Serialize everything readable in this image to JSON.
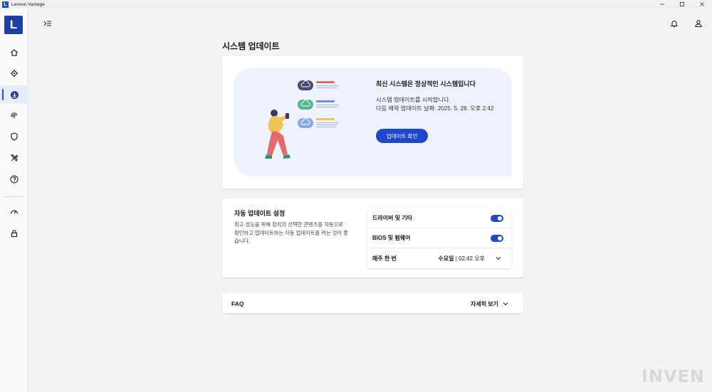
{
  "window": {
    "title": "Lenovo Vantage",
    "logo_letter": "L",
    "brand_color": "#1d4ed8"
  },
  "sidebar": {
    "brand_letter": "L",
    "items": [
      {
        "name": "home-icon",
        "active": false
      },
      {
        "name": "gear-icon",
        "active": false
      },
      {
        "name": "download-icon",
        "active": true
      },
      {
        "name": "fingerprint-icon",
        "active": false
      },
      {
        "name": "shield-icon",
        "active": false
      },
      {
        "name": "tools-icon",
        "active": false
      },
      {
        "name": "help-icon",
        "active": false
      },
      {
        "name": "gauge-icon",
        "active": false
      },
      {
        "name": "lock-icon",
        "active": false
      }
    ]
  },
  "page": {
    "title": "시스템 업데이트"
  },
  "status": {
    "title": "최신 시스템은 정상적인 시스템입니다",
    "line1": "시스템 업데이트를 시작합니다.",
    "line2": "다음 예약 업데이트 날짜: 2025. 5. 28. 오후 2:42",
    "button": "업데이트 확인"
  },
  "auto_update": {
    "title": "자동 업데이트 설정",
    "description": "최고 성능을 위해 장치의 선택한 콘텐츠를 자동으로 확인하고 업데이트하는 자동 업데이트를 켜는 것이 좋습니다.",
    "rows": [
      {
        "label": "드라이버 및 기타",
        "enabled": true
      },
      {
        "label": "BIOS 및 펌웨어",
        "enabled": true
      }
    ],
    "schedule": {
      "label": "매주 한 번",
      "day": "수요일",
      "separator": " | ",
      "time": "02:42 오후"
    }
  },
  "faq": {
    "label": "FAQ",
    "more": "자세히 보기"
  },
  "watermark": "INVEN"
}
